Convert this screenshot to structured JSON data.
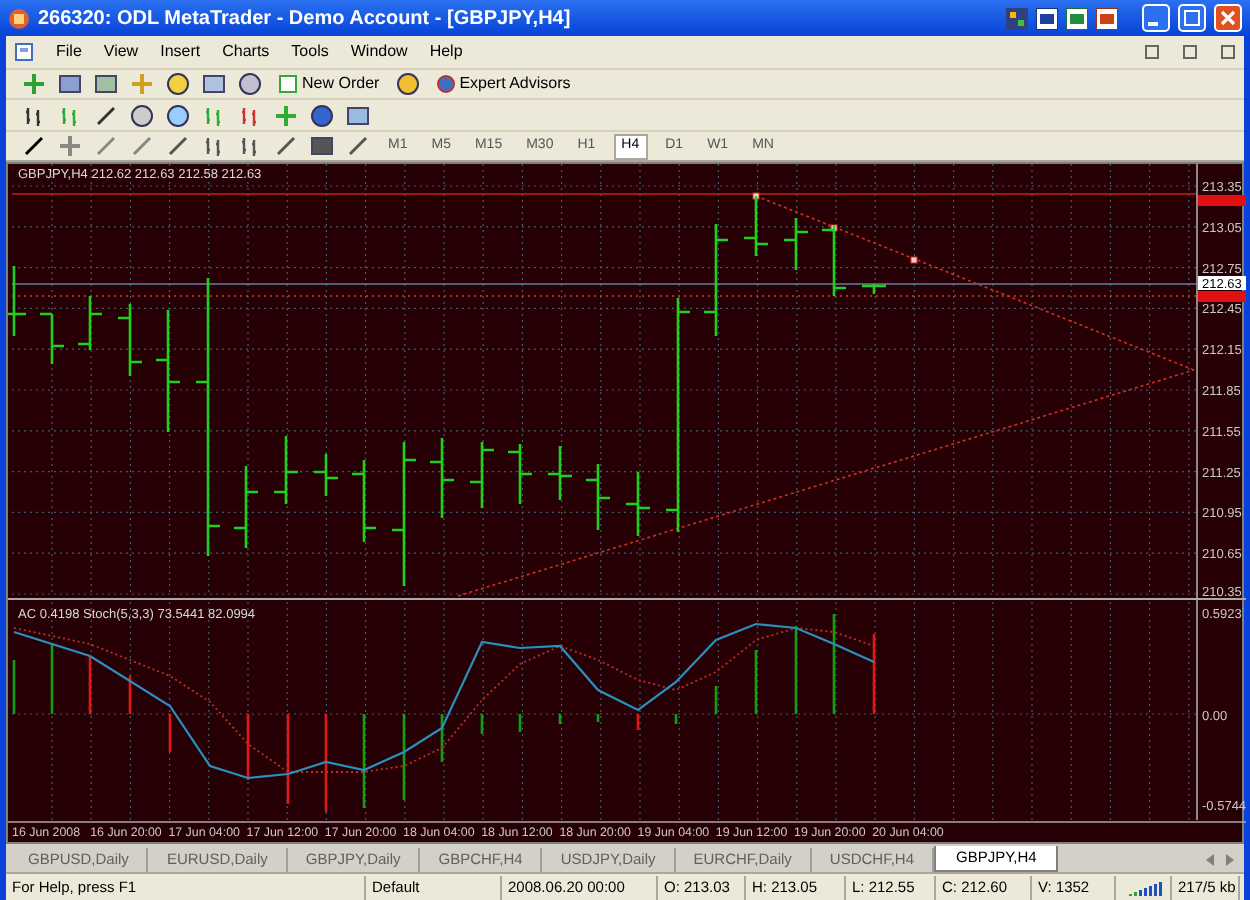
{
  "window": {
    "title": "266320: ODL MetaTrader - Demo Account - [GBPJPY,H4]"
  },
  "menu": [
    "File",
    "View",
    "Insert",
    "Charts",
    "Tools",
    "Window",
    "Help"
  ],
  "toolbar": {
    "new_order": "New Order",
    "expert_advisors": "Expert Advisors"
  },
  "timeframes": [
    {
      "label": "M1",
      "selected": false
    },
    {
      "label": "M5",
      "selected": false
    },
    {
      "label": "M15",
      "selected": false
    },
    {
      "label": "M30",
      "selected": false
    },
    {
      "label": "H1",
      "selected": false
    },
    {
      "label": "H4",
      "selected": true
    },
    {
      "label": "D1",
      "selected": false
    },
    {
      "label": "W1",
      "selected": false
    },
    {
      "label": "MN",
      "selected": false
    }
  ],
  "chart": {
    "legend": "GBPJPY,H4  212.62 212.63 212.58 212.63",
    "price_axis": [
      {
        "label": "213.35",
        "kind": "tick"
      },
      {
        "label": "213.05",
        "kind": "tick"
      },
      {
        "label": "212.75",
        "kind": "tick"
      },
      {
        "label": "212.45",
        "kind": "tick"
      },
      {
        "label": "212.15",
        "kind": "tick"
      },
      {
        "label": "211.85",
        "kind": "tick"
      },
      {
        "label": "211.55",
        "kind": "tick"
      },
      {
        "label": "211.25",
        "kind": "tick"
      },
      {
        "label": "210.95",
        "kind": "tick"
      },
      {
        "label": "210.65",
        "kind": "tick"
      },
      {
        "label": "210.35",
        "kind": "tick"
      }
    ],
    "current_price": "212.63",
    "indicator": {
      "legend": "AC 0.4198  Stoch(5,3,3) 73.5441 82.0994",
      "axis": [
        "0.5923",
        "0.00",
        "-0.5744"
      ]
    },
    "time_axis": [
      "16 Jun 2008",
      "16 Jun 20:00",
      "17 Jun 04:00",
      "17 Jun 12:00",
      "17 Jun 20:00",
      "18 Jun 04:00",
      "18 Jun 12:00",
      "18 Jun 20:00",
      "19 Jun 04:00",
      "19 Jun 12:00",
      "19 Jun 20:00",
      "20 Jun 04:00"
    ]
  },
  "tabs": [
    {
      "label": "GBPUSD,Daily",
      "selected": false
    },
    {
      "label": "EURUSD,Daily",
      "selected": false
    },
    {
      "label": "GBPJPY,Daily",
      "selected": false
    },
    {
      "label": "GBPCHF,H4",
      "selected": false
    },
    {
      "label": "USDJPY,Daily",
      "selected": false
    },
    {
      "label": "EURCHF,Daily",
      "selected": false
    },
    {
      "label": "USDCHF,H4",
      "selected": false
    },
    {
      "label": "GBPJPY,H4",
      "selected": true
    }
  ],
  "status_bar": [
    "For Help, press F1",
    "Default",
    "2008.06.20 00:00",
    "O: 213.03",
    "H: 213.05",
    "L: 212.55",
    "C: 212.60",
    "V: 1352",
    "217/5 kb"
  ]
}
